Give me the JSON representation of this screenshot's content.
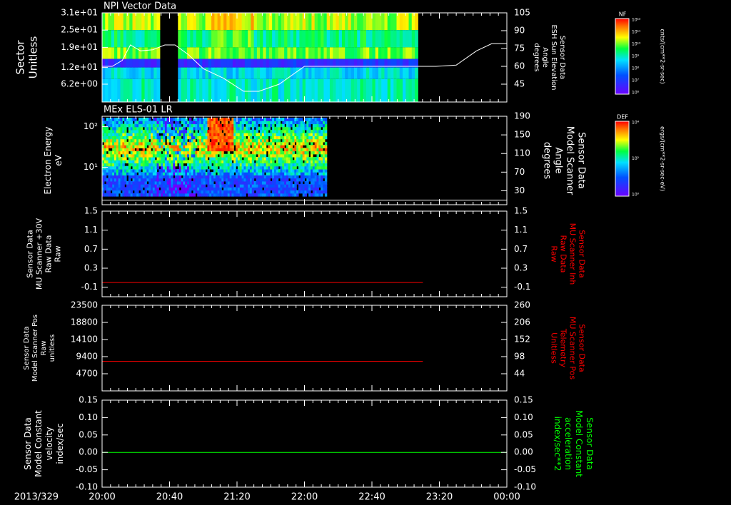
{
  "colors": {
    "background": "#000000",
    "frame": "#ffffff",
    "red": "#ff0000",
    "green": "#00ff00"
  },
  "time_axis": {
    "date_label": "2013/329",
    "ticks": [
      "20:00",
      "20:40",
      "21:20",
      "22:00",
      "22:40",
      "23:20",
      "00:00"
    ],
    "range_hours": [
      20.0,
      24.0
    ]
  },
  "colorbars": [
    {
      "tag": "NF",
      "units": "cnts/(cm**2-sr-sec)",
      "ticks": [
        "10¹²",
        "10¹¹",
        "10¹⁰",
        "10⁹",
        "10⁸",
        "10⁷",
        "10⁶"
      ]
    },
    {
      "tag": "DEF",
      "units": "ergs/(cm**2-sr-sec-eV)",
      "ticks": [
        "10⁴",
        "10²",
        "10⁰"
      ]
    }
  ],
  "chart_data": [
    {
      "type": "heatmap",
      "title": "NPI Vector Data",
      "ylabel": [
        "Sector",
        "Unitless"
      ],
      "yticks": [
        "3.1e+01",
        "2.5e+01",
        "1.9e+01",
        "1.2e+01",
        "6.2e+00"
      ],
      "ytick_values": [
        31,
        25,
        19,
        12,
        6.2
      ],
      "ylim": [
        0,
        31
      ],
      "gaps_hours": [
        [
          20.567,
          20.733
        ],
        [
          23.1,
          24.0
        ]
      ],
      "bands": [
        {
          "y": [
            25,
            31
          ],
          "level": 0.7
        },
        {
          "y": [
            19,
            25
          ],
          "level": 0.55
        },
        {
          "y": [
            15,
            19
          ],
          "level": 0.65
        },
        {
          "y": [
            12,
            15
          ],
          "level": 0.15
        },
        {
          "y": [
            8,
            12
          ],
          "level": 0.45
        },
        {
          "y": [
            0,
            8
          ],
          "level": 0.5
        }
      ],
      "overlay": {
        "label": [
          "Sensor Data",
          "ESH Sun Elevation",
          "Angle",
          "degrees"
        ],
        "yticks": [
          "105",
          "90",
          "75",
          "60",
          "45"
        ],
        "ylim": [
          30,
          105
        ],
        "x_hours": [
          20.0,
          20.1,
          20.2,
          20.28,
          20.38,
          20.5,
          20.62,
          20.72,
          20.85,
          21.0,
          21.2,
          21.4,
          21.55,
          21.75,
          22.0,
          22.5,
          23.0,
          23.3,
          23.5,
          23.7,
          23.85,
          24.0
        ],
        "y": [
          60,
          60,
          65,
          78,
          73,
          74,
          78,
          78,
          70,
          58,
          50,
          39,
          39,
          45,
          60,
          60,
          60,
          60,
          61,
          73,
          79,
          79
        ]
      }
    },
    {
      "type": "heatmap",
      "title": "MEx ELS-01 LR",
      "ylabel": [
        "Electron Energy",
        "eV"
      ],
      "yticks": [
        "10²",
        "10¹"
      ],
      "ylog": true,
      "ylim": [
        1.2,
        180
      ],
      "data_end_hour": 22.2,
      "feature_hours": [
        21.03,
        21.28
      ],
      "overlay": {
        "label": [
          "Sensor Data",
          "Model Scanner",
          "Angle",
          "degrees"
        ],
        "yticks": [
          "190",
          "150",
          "110",
          "70",
          "30"
        ],
        "ylim": [
          0,
          190
        ],
        "x_hours": [
          20.0,
          24.0
        ],
        "y": [
          10,
          10
        ]
      }
    },
    {
      "type": "line",
      "ylabel": [
        "Sensor Data",
        "MU Scanner +30V",
        "Raw Data",
        "Raw"
      ],
      "yticks": [
        "1.5",
        "1.1",
        "0.7",
        "0.3",
        "-0.1"
      ],
      "ylim": [
        -0.3,
        1.5
      ],
      "y2label": [
        "Sensor Data",
        "MU Scanner Inh",
        "Raw Data",
        "Raw"
      ],
      "y2ticks": [
        "1.5",
        "1.1",
        "0.7",
        "0.3",
        "-0.1"
      ],
      "series": [
        {
          "color": "#ff0000",
          "x_hours": [
            20.0,
            23.17
          ],
          "y": [
            0.0,
            0.0
          ]
        }
      ]
    },
    {
      "type": "line",
      "ylabel": [
        "Sensor Data",
        "Model Scanner Pos",
        "Raw",
        "unitless"
      ],
      "yticks": [
        "23500",
        "18800",
        "14100",
        "9400",
        "4700"
      ],
      "ylim": [
        0,
        23500
      ],
      "y2label": [
        "Sensor Data",
        "MU Scanner Pos",
        "Telemetry",
        "Unitless"
      ],
      "y2ticks": [
        "260",
        "206",
        "152",
        "98",
        "44"
      ],
      "series": [
        {
          "color": "#ff0000",
          "x_hours": [
            20.0,
            23.17
          ],
          "y": [
            8100,
            8100
          ]
        }
      ]
    },
    {
      "type": "line",
      "ylabel": [
        "Sensor Data",
        "Model Constant",
        "velocity",
        "index/sec"
      ],
      "yticks": [
        "0.15",
        "0.10",
        "0.05",
        "0.00",
        "-0.05",
        "-0.10"
      ],
      "ylim": [
        -0.1,
        0.15
      ],
      "y2label": [
        "Sensor Data",
        "Model Constant",
        "acceleration",
        "index/sec**2"
      ],
      "y2ticks": [
        "0.15",
        "0.10",
        "0.05",
        "0.00",
        "-0.05",
        "-0.10"
      ],
      "series": [
        {
          "color": "#00ff00",
          "x_hours": [
            20.0,
            24.0
          ],
          "y": [
            0.0,
            0.0
          ]
        }
      ]
    }
  ]
}
